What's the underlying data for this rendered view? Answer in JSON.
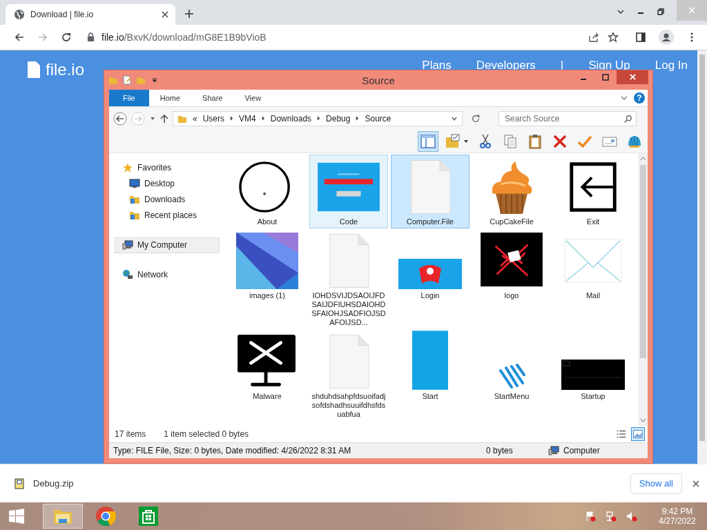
{
  "browser": {
    "tab": {
      "title": "Download | file.io"
    },
    "url": {
      "host": "file.io",
      "path": "/BxvK/download/mG8E1B9bVioB"
    }
  },
  "site": {
    "logo": "file.io",
    "nav": [
      "Plans",
      "Developers",
      "|",
      "Sign Up",
      "Log In"
    ]
  },
  "explorer": {
    "title": "Source",
    "ribbon_tabs": [
      {
        "label": "File",
        "selected": true
      },
      {
        "label": "Home",
        "selected": false
      },
      {
        "label": "Share",
        "selected": false
      },
      {
        "label": "View",
        "selected": false
      }
    ],
    "help": "?",
    "breadcrumb": [
      "«",
      "Users",
      "VM4",
      "Downloads",
      "Debug",
      "Source"
    ],
    "search": {
      "placeholder": "Search Source"
    },
    "toolbar": [
      {
        "kind": "preview-pane",
        "selected": true
      },
      {
        "kind": "folder-check",
        "selected": false
      },
      {
        "kind": "cut",
        "selected": false
      },
      {
        "kind": "copy",
        "selected": false
      },
      {
        "kind": "paste",
        "selected": false
      },
      {
        "kind": "delete",
        "selected": false
      },
      {
        "kind": "check",
        "selected": false
      },
      {
        "kind": "card",
        "selected": false
      },
      {
        "kind": "shell",
        "selected": false
      }
    ],
    "nav": [
      {
        "label": "Favorites",
        "selected": false,
        "children": [
          {
            "label": "Desktop",
            "selected": false
          },
          {
            "label": "Downloads",
            "selected": false
          },
          {
            "label": "Recent places",
            "selected": false
          }
        ]
      },
      {
        "label": "My Computer",
        "selected": true
      },
      {
        "label": "Network",
        "selected": false
      }
    ],
    "files": [
      {
        "name": "About",
        "selected": false,
        "hovered": false
      },
      {
        "name": "Code",
        "selected": false,
        "hovered": true
      },
      {
        "name": "Computer.File",
        "selected": true,
        "hovered": false
      },
      {
        "name": "CupCakeFile",
        "selected": false,
        "hovered": false
      },
      {
        "name": "Exit",
        "selected": false,
        "hovered": false
      },
      {
        "name": "images (1)",
        "selected": false,
        "hovered": false
      },
      {
        "name": "IOHDSVIJDSAOIJFDSAIJDFIUHSDAIOHDSFAIOHJSADFIOJSDAFOIJSD...",
        "selected": false,
        "hovered": false
      },
      {
        "name": "Login",
        "selected": false,
        "hovered": false
      },
      {
        "name": "logo",
        "selected": false,
        "hovered": false
      },
      {
        "name": "Mail",
        "selected": false,
        "hovered": false
      },
      {
        "name": "Malware",
        "selected": false,
        "hovered": false
      },
      {
        "name": "shduhdsahpfdsuoifadjsofdshadhsuuifdhsfdsuabfua",
        "selected": false,
        "hovered": false
      },
      {
        "name": "Start",
        "selected": false,
        "hovered": false
      },
      {
        "name": "StartMenu",
        "selected": false,
        "hovered": false
      },
      {
        "name": "Startup",
        "selected": false,
        "hovered": false
      }
    ],
    "status": {
      "count": "17 items",
      "selection": "1 item selected  0 bytes",
      "views": [
        {
          "kind": "details",
          "selected": false
        },
        {
          "kind": "large-icons",
          "selected": true
        }
      ]
    },
    "details": {
      "info": "Type: FILE File, Size: 0 bytes, Date modified: 4/26/2022 8:31 AM",
      "size": "0 bytes",
      "location": "Computer"
    }
  },
  "downloads": {
    "file": "Debug.zip",
    "show_all": "Show all"
  },
  "taskbar": {
    "apps": [
      {
        "kind": "explorer",
        "selected": true
      },
      {
        "kind": "chrome",
        "selected": false
      },
      {
        "kind": "store",
        "selected": false
      }
    ],
    "time": "9:42 PM",
    "date": "4/27/2022"
  }
}
